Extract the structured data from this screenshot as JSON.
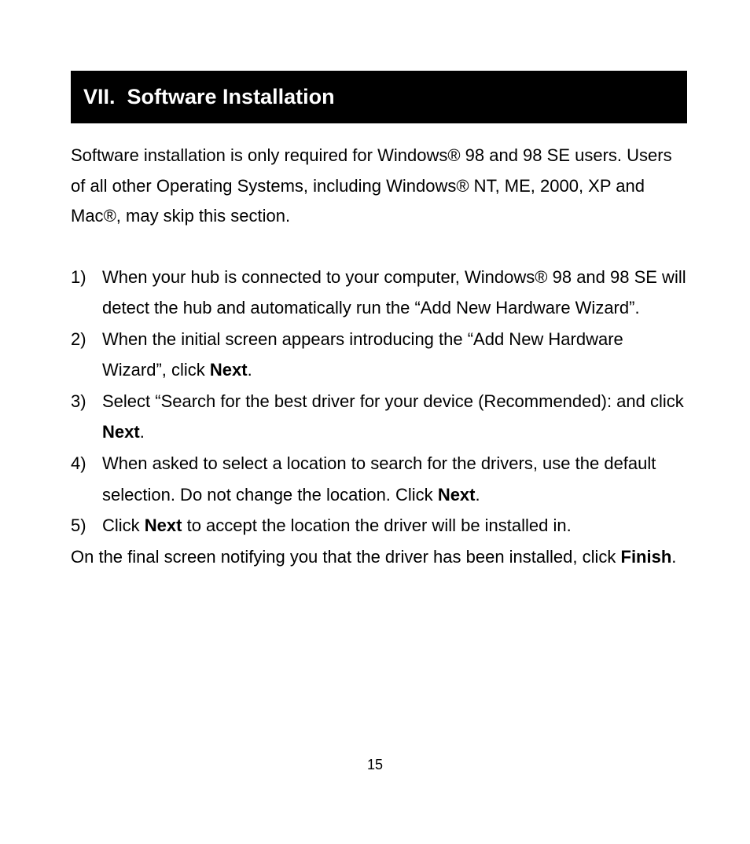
{
  "header": {
    "number": "VII.",
    "title": "Software Installation"
  },
  "intro": {
    "p1a": "Software installation is only required for Windows",
    "reg": "®",
    "p1b": " 98 and 98 SE users. Users of all other Operating Systems, including Windows",
    "p1c": " NT, ME, 2000, XP and Mac",
    "p1d": ", may skip this section."
  },
  "items": [
    {
      "num": "1)",
      "pre": "When your hub is connected to your computer, Windows",
      "reg": "®",
      "post": " 98 and 98 SE will detect the hub and automatically run the “Add New Hardware Wizard”."
    },
    {
      "num": "2)",
      "pre": "When the initial screen appears introducing the “Add New Hardware Wizard”, click ",
      "bold": "Next",
      "post": "."
    },
    {
      "num": "3)",
      "pre": "Select “Search for the best driver for your device (Recommended): and click ",
      "bold": "Next",
      "post": "."
    },
    {
      "num": "4)",
      "pre": "When asked to select a location to search for the drivers, use the default selection. Do not change the location. Click ",
      "bold": "Next",
      "post": "."
    },
    {
      "num": "5)",
      "pre": "Click ",
      "bold": "Next",
      "post": " to accept the location the driver will be installed in."
    }
  ],
  "closing": {
    "pre": "On the final screen notifying you that the driver has been installed, click ",
    "bold": "Finish",
    "post": "."
  },
  "page_number": "15"
}
